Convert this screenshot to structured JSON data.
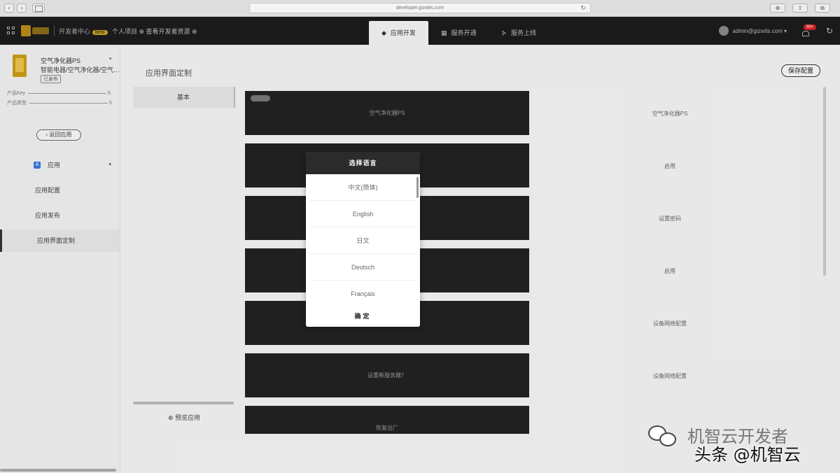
{
  "browser": {
    "url": "developer.gizwits.com",
    "back": "‹",
    "forward": "›",
    "reload": "↻",
    "right_buttons": [
      "⊕",
      "⇧",
      "⧉"
    ]
  },
  "header": {
    "dev_center": "开发者中心",
    "dev_badge": "beta",
    "links": "个人项目 ⊕ 查看开发者资源 ⊕",
    "tabs": [
      {
        "label": "应用开发",
        "icon": "◆"
      },
      {
        "label": "服务开通",
        "icon": "▦"
      },
      {
        "label": "服务上线",
        "icon": "⊱"
      }
    ],
    "user": "admin@gizwits.com ▾",
    "notif": "99+",
    "refresh": "↻"
  },
  "sidebar": {
    "product_name": "空气净化器PS",
    "product_sub": "智能电器/空气净化器/空气…",
    "product_tag": "已发布",
    "meta": [
      {
        "k": "产品Key",
        "v": "5"
      },
      {
        "k": "产品类型",
        "v": "5"
      }
    ],
    "back_label": "‹ 返回应用",
    "group_label": "应用",
    "group_icon": "A",
    "items": [
      "应用配置",
      "应用发布",
      "应用界面定制"
    ]
  },
  "main": {
    "title": "应用界面定制",
    "save": "保存配置",
    "basic_tab": "基本",
    "preview": "⊕ 预览应用",
    "blocks": [
      "空气净化器PS",
      "",
      "",
      "",
      "",
      "设置新服务器？",
      "恢复出厂"
    ],
    "right_labels": [
      "空气净化器PS",
      "启用",
      "设置密码",
      "启用",
      "设备网络配置",
      "设备网络配置"
    ]
  },
  "modal": {
    "title": "选择语言",
    "options": [
      "中文(简体)",
      "English",
      "日文",
      "Deutsch",
      "Français"
    ],
    "confirm": "确定"
  },
  "watermark": {
    "line1": "机智云开发者",
    "line2": "头条 @机智云"
  }
}
